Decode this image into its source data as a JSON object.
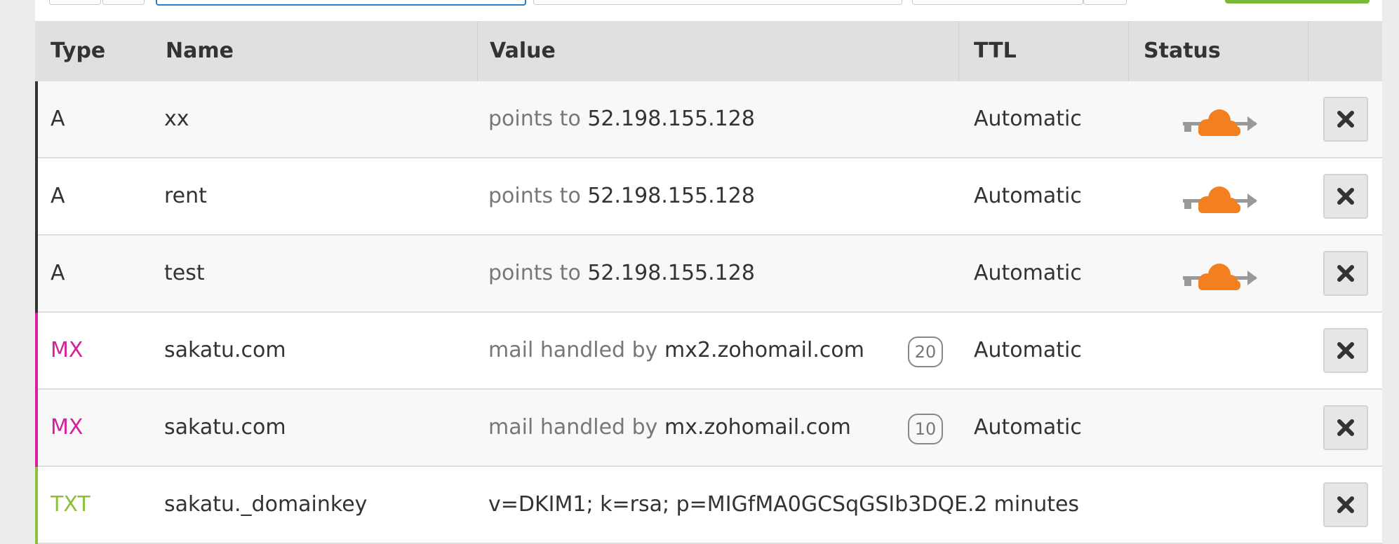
{
  "columns": {
    "type": "Type",
    "name": "Name",
    "value": "Value",
    "ttl": "TTL",
    "status": "Status"
  },
  "colors": {
    "a": "#333333",
    "mx": "#d5219b",
    "txt": "#8dbf3a",
    "cloud": "#f38020",
    "arrow": "#999999"
  },
  "records": [
    {
      "type": "A",
      "name": "xx",
      "value_prefix": "points to",
      "value": "52.198.155.128",
      "priority": "",
      "ttl": "Automatic",
      "proxied": true
    },
    {
      "type": "A",
      "name": "rent",
      "value_prefix": "points to",
      "value": "52.198.155.128",
      "priority": "",
      "ttl": "Automatic",
      "proxied": true
    },
    {
      "type": "A",
      "name": "test",
      "value_prefix": "points to",
      "value": "52.198.155.128",
      "priority": "",
      "ttl": "Automatic",
      "proxied": true
    },
    {
      "type": "MX",
      "name": "sakatu.com",
      "value_prefix": "mail handled by",
      "value": "mx2.zohomail.com",
      "priority": "20",
      "ttl": "Automatic",
      "proxied": false
    },
    {
      "type": "MX",
      "name": "sakatu.com",
      "value_prefix": "mail handled by",
      "value": "mx.zohomail.com",
      "priority": "10",
      "ttl": "Automatic",
      "proxied": false
    },
    {
      "type": "TXT",
      "name": "sakatu._domainkey",
      "value_prefix": "",
      "value": "v=DKIM1; k=rsa; p=MIGfMA0GCSqGSIb3DQE...",
      "priority": "",
      "ttl": "2 minutes",
      "proxied": false
    }
  ],
  "icons": {
    "status": "cloud-proxied-icon",
    "delete": "close-x-icon"
  }
}
